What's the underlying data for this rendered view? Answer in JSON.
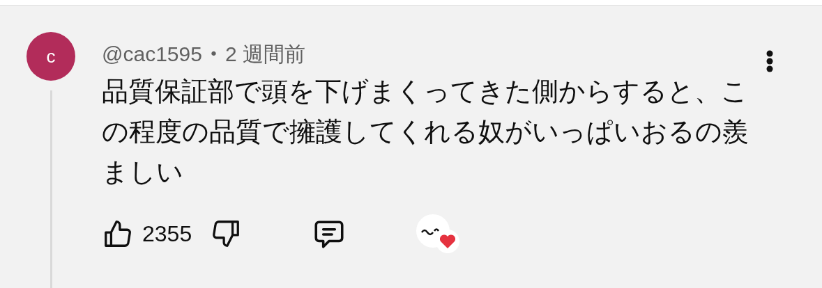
{
  "comment": {
    "avatar_letter": "c",
    "author": "@cac1595",
    "separator": "•",
    "time": "2 週間前",
    "text": "品質保証部で頭を下げまくってきた側からすると、この程度の品質で擁護してくれる奴がいっぱいおるの羨ましい",
    "like_count": "2355",
    "creator_hearted": true
  }
}
